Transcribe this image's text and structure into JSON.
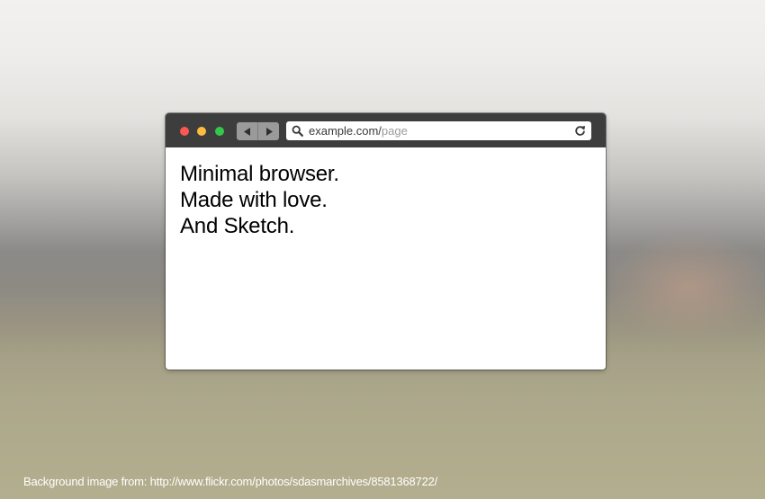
{
  "browser": {
    "traffic_lights": {
      "close_color": "#fc5753",
      "minimize_color": "#fdbc40",
      "zoom_color": "#34c84a"
    },
    "nav": {
      "back_icon": "triangle-left-icon",
      "forward_icon": "triangle-right-icon"
    },
    "address_bar": {
      "search_icon": "magnifier-icon",
      "url_domain": "example.com/",
      "url_path": "page",
      "reload_icon": "reload-icon"
    },
    "content": {
      "lines": [
        "Minimal browser.",
        "Made with love.",
        "And Sketch."
      ]
    }
  },
  "footer": {
    "credit": "Background image from: http://www.flickr.com/photos/sdasmarchives/8581368722/"
  }
}
